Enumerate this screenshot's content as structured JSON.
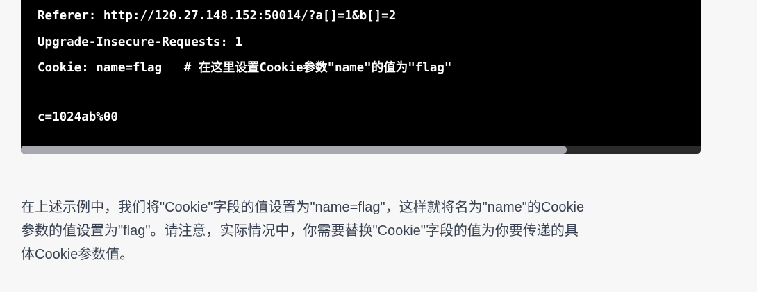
{
  "code": {
    "lines": [
      "Referer: http://120.27.148.152:50014/?a[]=1&b[]=2",
      "Upgrade-Insecure-Requests: 1",
      "Cookie: name=flag   # 在这里设置Cookie参数\"name\"的值为\"flag\"",
      "",
      "c=1024ab%00"
    ]
  },
  "explanation": {
    "lines": [
      "在上述示例中，我们将\"Cookie\"字段的值设置为\"name=flag\"，这样就将名为\"name\"的Cookie",
      "参数的值设置为\"flag\"。请注意，实际情况中，你需要替换\"Cookie\"字段的值为你要传递的具",
      "体Cookie参数值。"
    ]
  }
}
